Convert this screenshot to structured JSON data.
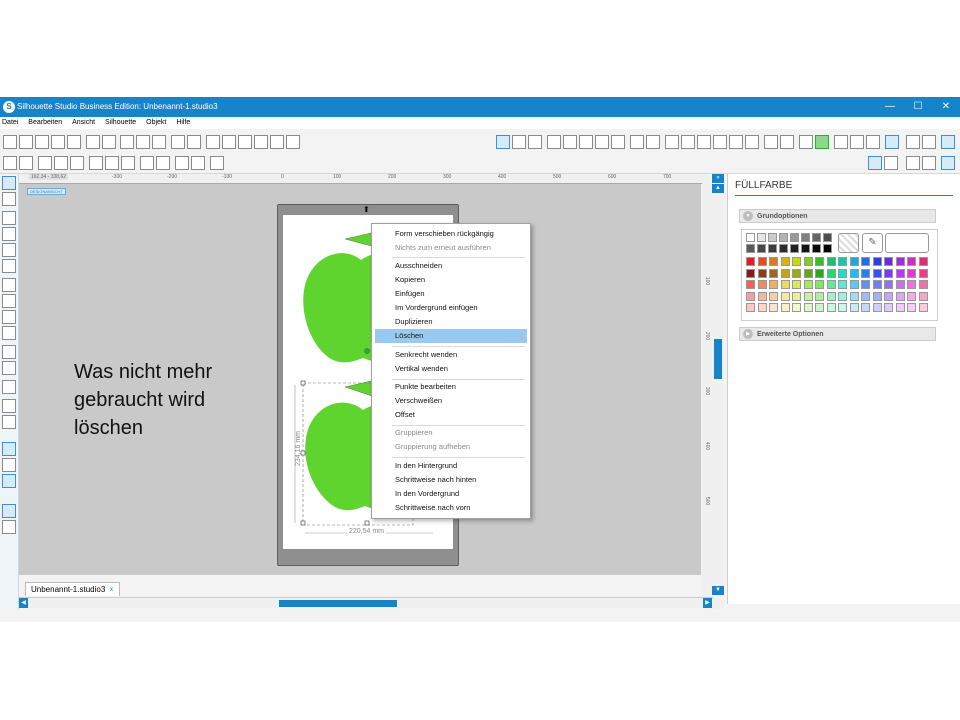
{
  "window": {
    "title": "Silhouette Studio Business Edition: Unbenannt-1.studio3",
    "controls": {
      "minimize": "—",
      "maximize": "☐",
      "close": "✕"
    }
  },
  "menu": [
    "Datei",
    "Bearbeiten",
    "Ansicht",
    "Silhouette",
    "Objekt",
    "Hilfe"
  ],
  "canvas": {
    "coords": "162,34 - 338,62",
    "mode_badge": "DESIGNANSICHT",
    "ruler_h": [
      "-300",
      "-200",
      "-100",
      "0",
      "100",
      "200",
      "300",
      "400",
      "500",
      "600",
      "700"
    ],
    "ruler_v": [
      "100",
      "200",
      "300",
      "400",
      "500"
    ],
    "dimension_width": "220,54 mm",
    "dimension_height": "234,16 mm",
    "shape_color": "#5fd42f"
  },
  "doc_tab": {
    "label": "Unbenannt-1.studio3",
    "close": "x"
  },
  "context_menu": [
    {
      "label": "Form verschieben rückgängig",
      "enabled": true
    },
    {
      "label": "Nichts zum erneut ausführen",
      "enabled": false
    },
    {
      "label": "Ausschneiden",
      "enabled": true
    },
    {
      "label": "Kopieren",
      "enabled": true
    },
    {
      "label": "Einfügen",
      "enabled": true
    },
    {
      "label": "Im Vordergrund einfügen",
      "enabled": true
    },
    {
      "label": "Duplizieren",
      "enabled": true
    },
    {
      "label": "Löschen",
      "enabled": true,
      "highlighted": true
    },
    {
      "label": "Senkrecht wenden",
      "enabled": true
    },
    {
      "label": "Vertikal wenden",
      "enabled": true
    },
    {
      "label": "Punkte bearbeiten",
      "enabled": true
    },
    {
      "label": "Verschweißen",
      "enabled": true
    },
    {
      "label": "Offset",
      "enabled": true
    },
    {
      "label": "Gruppieren",
      "enabled": false
    },
    {
      "label": "Gruppierung aufheben",
      "enabled": false
    },
    {
      "label": "In den Hintergrund",
      "enabled": true
    },
    {
      "label": "Schrittweise nach hinten",
      "enabled": true
    },
    {
      "label": "In den Vordergrund",
      "enabled": true
    },
    {
      "label": "Schrittweise nach vorn",
      "enabled": true
    }
  ],
  "panel": {
    "title": "FÜLLFARBE",
    "basic_options": "Grundoptionen",
    "advanced_options": "Erweiterte Optionen",
    "accent": "#1783c8"
  },
  "palette": {
    "grays": [
      "#ffffff",
      "#e6e6e6",
      "#cccccc",
      "#b3b3b3",
      "#999999",
      "#808080",
      "#666666",
      "#4d4d4d"
    ],
    "darks": [
      "#595959",
      "#4a4a4a",
      "#3c3c3c",
      "#2e2e2e",
      "#202020",
      "#141414",
      "#0a0a0a",
      "#000000"
    ],
    "rows": [
      [
        "#e02020",
        "#e04e1b",
        "#e07b1b",
        "#e0b01b",
        "#c9d41b",
        "#7fcf1b",
        "#36c21b",
        "#1bc26b",
        "#1bc2b0",
        "#1ba9e0",
        "#1b6fe0",
        "#2a3fe0",
        "#6a2ae0",
        "#a52ae0",
        "#d42ac9",
        "#e02a7a"
      ],
      [
        "#8b1a1a",
        "#8b3a1a",
        "#a0641a",
        "#c8a21a",
        "#9aa81a",
        "#5ea81a",
        "#2ba81a",
        "#26d96b",
        "#26d9c8",
        "#26b8f0",
        "#2680f0",
        "#3a4ff0",
        "#7a3af0",
        "#b43af0",
        "#e03ad8",
        "#f03a8c"
      ],
      [
        "#f06060",
        "#f08a60",
        "#f0b060",
        "#f0d860",
        "#d8e860",
        "#a8e860",
        "#7ae860",
        "#60e8a0",
        "#60e8d8",
        "#60c8f0",
        "#6090f0",
        "#7080f0",
        "#9a70f0",
        "#c870f0",
        "#f070e0",
        "#f070a8"
      ],
      [
        "#f5a0a0",
        "#f5b8a0",
        "#f5d0a0",
        "#f5e8a0",
        "#e8f0a0",
        "#c8f0a0",
        "#b0f0a0",
        "#a0f0c8",
        "#a0f0e8",
        "#a0dcf5",
        "#a0bcf5",
        "#a8b0f5",
        "#c0a8f5",
        "#dca8f5",
        "#f5a8ec",
        "#f5a8c8"
      ],
      [
        "#f9c8c8",
        "#f9d8c8",
        "#f9e4c8",
        "#f9f0c8",
        "#f0f7c8",
        "#dcf7c8",
        "#ccf7c8",
        "#c8f7dc",
        "#c8f7f0",
        "#c8eaf9",
        "#c8d8f9",
        "#ccd0f9",
        "#dcccf9",
        "#ecccf9",
        "#f9ccf4",
        "#f9ccdc"
      ]
    ]
  },
  "annotation": "Was nicht mehr gebraucht wird löschen"
}
